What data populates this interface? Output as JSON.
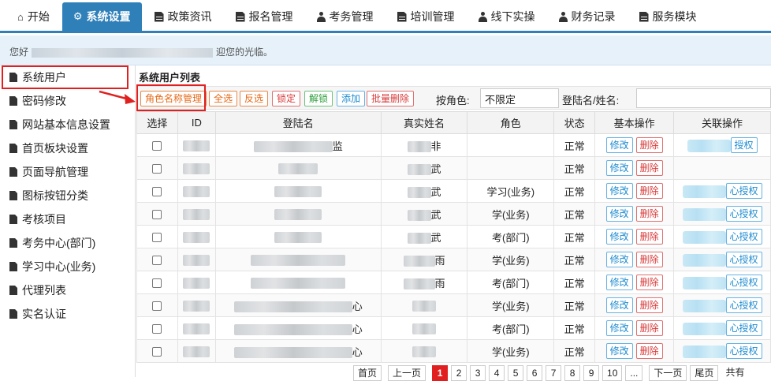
{
  "nav": {
    "items": [
      {
        "label": "开始",
        "icon": "home-icon"
      },
      {
        "label": "系统设置",
        "icon": "gear-icon",
        "active": true
      },
      {
        "label": "政策资讯",
        "icon": "document-icon"
      },
      {
        "label": "报名管理",
        "icon": "document-icon"
      },
      {
        "label": "考务管理",
        "icon": "user-icon"
      },
      {
        "label": "培训管理",
        "icon": "document-icon"
      },
      {
        "label": "线下实操",
        "icon": "user-icon"
      },
      {
        "label": "财务记录",
        "icon": "user-icon"
      },
      {
        "label": "服务模块",
        "icon": "document-icon"
      }
    ],
    "accent": "#2f7fb8"
  },
  "greeting": {
    "prefix": "您好",
    "suffix": "迎您的光临。"
  },
  "sidebar": {
    "items": [
      {
        "label": "系统用户",
        "active": true
      },
      {
        "label": "密码修改"
      },
      {
        "label": "网站基本信息设置"
      },
      {
        "label": "首页板块设置"
      },
      {
        "label": "页面导航管理"
      },
      {
        "label": "图标按钮分类"
      },
      {
        "label": "考核项目"
      },
      {
        "label": "考务中心(部门)"
      },
      {
        "label": "学习中心(业务)"
      },
      {
        "label": "代理列表"
      },
      {
        "label": "实名认证"
      }
    ]
  },
  "main": {
    "title": "系统用户列表",
    "toolbar": {
      "role_name_manage": "角色名称管理",
      "select_all": "全选",
      "invert": "反选",
      "lock": "锁定",
      "unlock": "解锁",
      "add": "添加",
      "batch_delete": "批量删除",
      "role_filter_label": "按角色:",
      "role_filter_value": "不限定",
      "login_filter_label": "登陆名/姓名:"
    },
    "table": {
      "headers": [
        "选择",
        "ID",
        "登陆名",
        "真实姓名",
        "角色",
        "状态",
        "基本操作",
        "关联操作"
      ],
      "rows": [
        {
          "login_suffix": "监",
          "name_suffix": "非",
          "role": "",
          "status": "正常",
          "auth": "授权"
        },
        {
          "login_suffix": "",
          "name_suffix": "武",
          "role": "",
          "status": "正常",
          "auth": ""
        },
        {
          "login_suffix": "",
          "name_suffix": "武",
          "role": "学习(业务)",
          "status": "正常",
          "auth": "心授权"
        },
        {
          "login_suffix": "",
          "name_suffix": "武",
          "role": "学(业务)",
          "status": "正常",
          "auth": "心授权"
        },
        {
          "login_suffix": "",
          "name_suffix": "武",
          "role": "考(部门)",
          "status": "正常",
          "auth": "心授权"
        },
        {
          "login_suffix": "",
          "name_suffix": "雨",
          "role": "学(业务)",
          "status": "正常",
          "auth": "心授权"
        },
        {
          "login_suffix": "",
          "name_suffix": "雨",
          "role": "考(部门)",
          "status": "正常",
          "auth": "心授权"
        },
        {
          "login_suffix": "心",
          "name_suffix": "",
          "role": "学(业务)",
          "status": "正常",
          "auth": "心授权"
        },
        {
          "login_suffix": "心",
          "name_suffix": "",
          "role": "考(部门)",
          "status": "正常",
          "auth": "心授权"
        },
        {
          "login_suffix": "心",
          "name_suffix": "",
          "role": "学(业务)",
          "status": "正常",
          "auth": "心授权"
        }
      ],
      "edit_label": "修改",
      "delete_label": "删除"
    },
    "pager": {
      "first": "首页",
      "prev": "上一页",
      "pages": [
        "1",
        "2",
        "3",
        "4",
        "5",
        "6",
        "7",
        "8",
        "9",
        "10"
      ],
      "current": "1",
      "ellipsis": "...",
      "next": "下一页",
      "last": "尾页",
      "total": "共有"
    }
  }
}
